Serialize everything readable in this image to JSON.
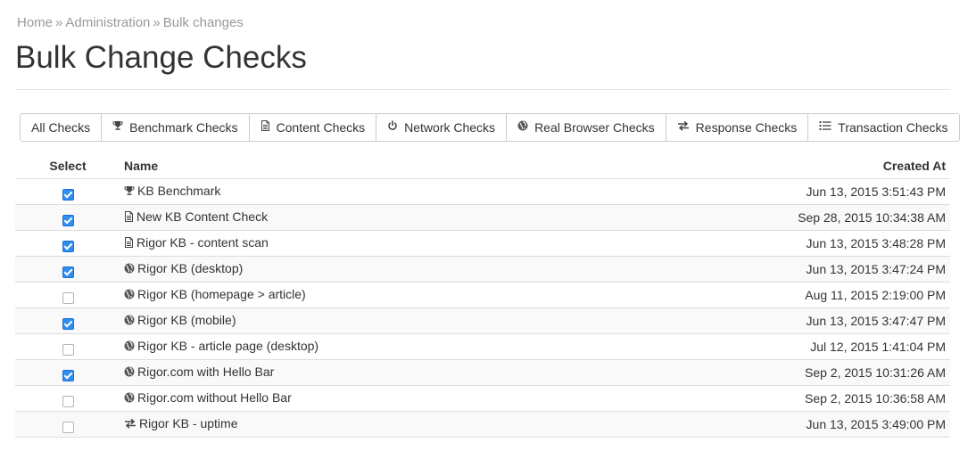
{
  "breadcrumb": {
    "home": "Home",
    "sep": "»",
    "admin": "Administration",
    "current": "Bulk changes"
  },
  "page_title": "Bulk Change Checks",
  "filters": [
    {
      "label": "All Checks",
      "icon": ""
    },
    {
      "label": "Benchmark Checks",
      "icon": "trophy-icon"
    },
    {
      "label": "Content Checks",
      "icon": "document-icon"
    },
    {
      "label": "Network Checks",
      "icon": "power-icon"
    },
    {
      "label": "Real Browser Checks",
      "icon": "globe-icon"
    },
    {
      "label": "Response Checks",
      "icon": "swap-arrows-icon"
    },
    {
      "label": "Transaction Checks",
      "icon": "list-icon"
    }
  ],
  "table": {
    "headers": {
      "select": "Select",
      "name": "Name",
      "created": "Created At"
    },
    "rows": [
      {
        "checked": true,
        "icon": "trophy-icon",
        "name": "KB Benchmark",
        "created": "Jun 13, 2015 3:51:43 PM"
      },
      {
        "checked": true,
        "icon": "document-icon",
        "name": "New KB Content Check",
        "created": "Sep 28, 2015 10:34:38 AM"
      },
      {
        "checked": true,
        "icon": "document-icon",
        "name": "Rigor KB - content scan",
        "created": "Jun 13, 2015 3:48:28 PM"
      },
      {
        "checked": true,
        "icon": "globe-icon",
        "name": "Rigor KB (desktop)",
        "created": "Jun 13, 2015 3:47:24 PM"
      },
      {
        "checked": false,
        "icon": "globe-icon",
        "name": "Rigor KB (homepage > article)",
        "created": "Aug 11, 2015 2:19:00 PM"
      },
      {
        "checked": true,
        "icon": "globe-icon",
        "name": "Rigor KB (mobile)",
        "created": "Jun 13, 2015 3:47:47 PM"
      },
      {
        "checked": false,
        "icon": "globe-icon",
        "name": "Rigor KB - article page (desktop)",
        "created": "Jul 12, 2015 1:41:04 PM"
      },
      {
        "checked": true,
        "icon": "globe-icon",
        "name": "Rigor.com with Hello Bar",
        "created": "Sep 2, 2015 10:31:26 AM"
      },
      {
        "checked": false,
        "icon": "globe-icon",
        "name": "Rigor.com without Hello Bar",
        "created": "Sep 2, 2015 10:36:58 AM"
      },
      {
        "checked": false,
        "icon": "swap-arrows-icon",
        "name": "Rigor KB - uptime",
        "created": "Jun 13, 2015 3:49:00 PM"
      }
    ]
  },
  "colors": {
    "checkbox_checked": "#2f8cf0",
    "muted_text": "#999999",
    "border": "#dddddd"
  }
}
